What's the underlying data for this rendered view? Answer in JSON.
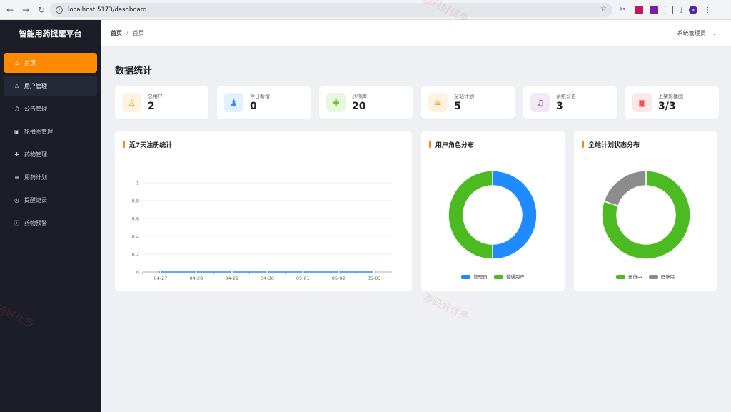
{
  "browser": {
    "url": "localhost:5173/dashboard"
  },
  "sidebar": {
    "logo": "智能用药提醒平台",
    "items": [
      {
        "label": "首页",
        "icon": "home-icon"
      },
      {
        "label": "用户管理",
        "icon": "user-icon"
      },
      {
        "label": "公告管理",
        "icon": "bell-icon"
      },
      {
        "label": "轮播图管理",
        "icon": "image-icon"
      },
      {
        "label": "药物管理",
        "icon": "medkit-icon"
      },
      {
        "label": "用药计划",
        "icon": "doc-icon"
      },
      {
        "label": "提醒记录",
        "icon": "clock-icon"
      },
      {
        "label": "药物预警",
        "icon": "alert-icon"
      }
    ]
  },
  "header": {
    "breadcrumb": [
      "首页",
      "首页"
    ],
    "user": "系统管理员"
  },
  "page": {
    "title": "数据统计"
  },
  "stats": [
    {
      "label": "总用户",
      "value": "2",
      "icon": "user-icon",
      "color": "#f5a623"
    },
    {
      "label": "今日新增",
      "value": "0",
      "icon": "user-add-icon",
      "color": "#2f8cff"
    },
    {
      "label": "药物库",
      "value": "20",
      "icon": "medkit-icon",
      "color": "#52c41a"
    },
    {
      "label": "全站计划",
      "value": "5",
      "icon": "doc-icon",
      "color": "#f5a623"
    },
    {
      "label": "系统公告",
      "value": "3",
      "icon": "bell-icon",
      "color": "#9b59b6"
    },
    {
      "label": "上架轮播图",
      "value": "3/3",
      "icon": "image-icon",
      "color": "#e8565a"
    }
  ],
  "charts": {
    "line_title": "近7天注册统计",
    "role_title": "用户角色分布",
    "plan_title": "全站计划状态分布"
  },
  "chart_data": [
    {
      "type": "line",
      "title": "近7天注册统计",
      "categories": [
        "04-27",
        "04-28",
        "04-29",
        "04-30",
        "05-01",
        "05-02",
        "05-03"
      ],
      "values": [
        0,
        0,
        0,
        0,
        0,
        0,
        0
      ],
      "ylim": [
        0,
        1
      ],
      "yticks": [
        "0",
        "0.2",
        "0.4",
        "0.6",
        "0.8",
        "1"
      ],
      "color": "#2f8cff",
      "grid": true
    },
    {
      "type": "pie",
      "title": "用户角色分布",
      "categories": [
        "管理员",
        "普通用户"
      ],
      "values": [
        1,
        1
      ],
      "colors": [
        "#1f8bff",
        "#4cbb22"
      ]
    },
    {
      "type": "pie",
      "title": "全站计划状态分布",
      "categories": [
        "进行中",
        "已停用"
      ],
      "values": [
        4,
        1
      ],
      "colors": [
        "#4cbb22",
        "#8c8c8c"
      ]
    }
  ],
  "watermark": "源码好优多"
}
